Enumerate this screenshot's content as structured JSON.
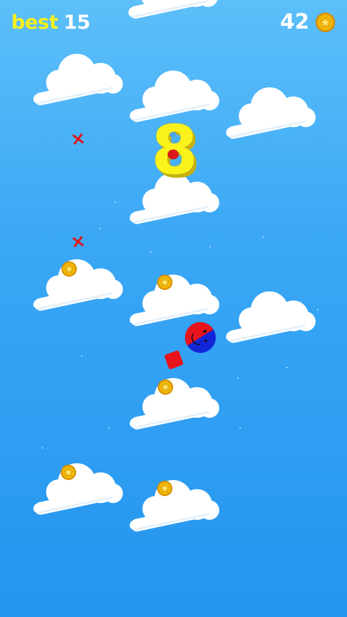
{
  "hud": {
    "best_label": "best",
    "best_value": "15",
    "coins_value": "42",
    "coin_icon": "star-coin-icon"
  },
  "game": {
    "current_score": "8",
    "player_icon": "red-blue-ball-player",
    "obstacle_icon": "red-square-obstacle",
    "enemy_marker": "×",
    "colors": {
      "sky_top": "#5cbff9",
      "sky_bottom": "#2495ef",
      "accent_yellow": "#f6f01e",
      "player_red": "#e8141c",
      "player_blue": "#1226d8",
      "coin_gold": "#f2b705",
      "cloud": "#ffffff"
    }
  }
}
